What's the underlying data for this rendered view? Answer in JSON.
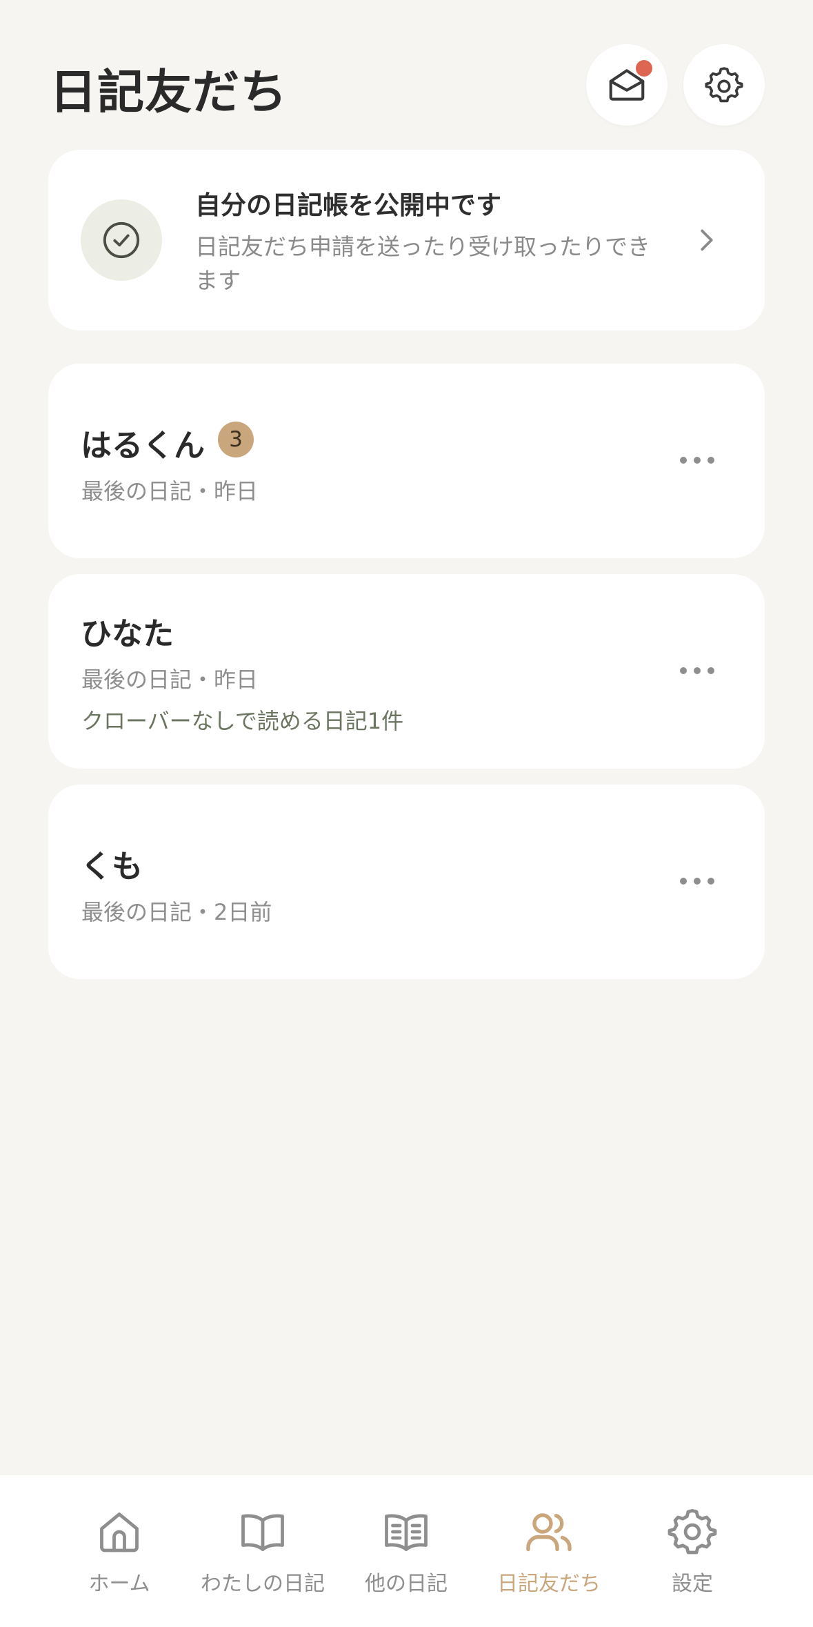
{
  "header": {
    "title": "日記友だち",
    "mail_icon": "mail-open-icon",
    "settings_icon": "gear-icon",
    "has_notification": true
  },
  "status_card": {
    "title": "自分の日記帳を公開中です",
    "description": "日記友だち申請を送ったり受け取ったりできます",
    "icon": "check-circle-icon"
  },
  "friends": [
    {
      "name": "はるくん",
      "badge": "3",
      "last_diary": "最後の日記・昨日",
      "extra": ""
    },
    {
      "name": "ひなた",
      "badge": "",
      "last_diary": "最後の日記・昨日",
      "extra": "クローバーなしで読める日記1件"
    },
    {
      "name": "くも",
      "badge": "",
      "last_diary": "最後の日記・2日前",
      "extra": ""
    }
  ],
  "nav": {
    "items": [
      {
        "label": "ホーム",
        "icon": "home-icon"
      },
      {
        "label": "わたしの日記",
        "icon": "book-open-icon"
      },
      {
        "label": "他の日記",
        "icon": "book-lines-icon"
      },
      {
        "label": "日記友だち",
        "icon": "users-icon",
        "active": true
      },
      {
        "label": "設定",
        "icon": "gear-icon"
      }
    ]
  },
  "colors": {
    "background": "#f6f5f2",
    "accent": "#c9a67c",
    "notification": "#dd6552",
    "card": "#ffffff"
  }
}
